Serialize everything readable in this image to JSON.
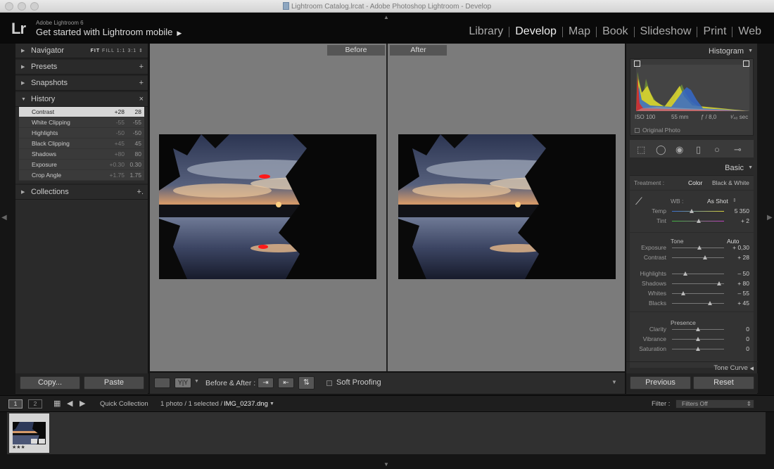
{
  "window": {
    "title": "Lightroom Catalog.lrcat - Adobe Photoshop Lightroom - Develop"
  },
  "identity": {
    "logo": "Lr",
    "product": "Adobe Lightroom 6",
    "mobile_prompt": "Get started with Lightroom mobile",
    "mobile_arrow": "▶"
  },
  "modules": [
    {
      "label": "Library",
      "active": false
    },
    {
      "label": "Develop",
      "active": true
    },
    {
      "label": "Map",
      "active": false
    },
    {
      "label": "Book",
      "active": false
    },
    {
      "label": "Slideshow",
      "active": false
    },
    {
      "label": "Print",
      "active": false
    },
    {
      "label": "Web",
      "active": false
    }
  ],
  "left_panel": {
    "navigator": {
      "title": "Navigator",
      "opt_fit": "FIT",
      "opt_fill": "FILL",
      "opt_1": "1:1",
      "opt_3": "3:1",
      "opt_arrow": "⇕"
    },
    "presets": {
      "title": "Presets",
      "action": "+"
    },
    "snapshots": {
      "title": "Snapshots",
      "action": "+"
    },
    "history": {
      "title": "History",
      "action": "×",
      "items": [
        {
          "name": "Contrast",
          "delta": "+28",
          "value": "28",
          "selected": true
        },
        {
          "name": "White Clipping",
          "delta": "-55",
          "value": "-55",
          "selected": false
        },
        {
          "name": "Highlights",
          "delta": "-50",
          "value": "-50",
          "selected": false
        },
        {
          "name": "Black Clipping",
          "delta": "+45",
          "value": "45",
          "selected": false
        },
        {
          "name": "Shadows",
          "delta": "+80",
          "value": "80",
          "selected": false
        },
        {
          "name": "Exposure",
          "delta": "+0.30",
          "value": "0.30",
          "selected": false
        },
        {
          "name": "Crop Angle",
          "delta": "+1.75",
          "value": "1.75",
          "selected": false
        }
      ]
    },
    "collections": {
      "title": "Collections",
      "action": "+."
    },
    "copy_label": "Copy...",
    "paste_label": "Paste"
  },
  "center": {
    "before_label": "Before",
    "after_label": "After"
  },
  "toolbar": {
    "view_yy": "Y|Y",
    "ba_label": "Before & After :",
    "soft_proofing": "Soft Proofing",
    "dropdown_arrow": "▼"
  },
  "right_panel": {
    "histogram": {
      "title": "Histogram",
      "iso": "ISO 100",
      "focal": "55 mm",
      "aperture": "ƒ / 8,0",
      "shutter": "¹⁄₄₀ sec",
      "original_photo": "Original Photo"
    },
    "basic": {
      "title": "Basic",
      "treatment_label": "Treatment :",
      "treatment_color": "Color",
      "treatment_bw": "Black & White",
      "wb_label": "WB :",
      "wb_value": "As Shot",
      "tone_label": "Tone",
      "auto_label": "Auto",
      "presence_label": "Presence",
      "sliders": [
        {
          "label": "Temp",
          "value": "5 350",
          "pos": 0.38
        },
        {
          "label": "Tint",
          "value": "+ 2",
          "pos": 0.52
        },
        {
          "label": "Exposure",
          "value": "+ 0,30",
          "pos": 0.53
        },
        {
          "label": "Contrast",
          "value": "+ 28",
          "pos": 0.64
        },
        {
          "label": "Highlights",
          "value": "– 50",
          "pos": 0.25
        },
        {
          "label": "Shadows",
          "value": "+ 80",
          "pos": 0.9
        },
        {
          "label": "Whites",
          "value": "– 55",
          "pos": 0.22
        },
        {
          "label": "Blacks",
          "value": "+ 45",
          "pos": 0.73
        },
        {
          "label": "Clarity",
          "value": "0",
          "pos": 0.5
        },
        {
          "label": "Vibrance",
          "value": "0",
          "pos": 0.5
        },
        {
          "label": "Saturation",
          "value": "0",
          "pos": 0.5
        }
      ]
    },
    "tone_curve": "Tone Curve",
    "previous_label": "Previous",
    "reset_label": "Reset"
  },
  "filmbar": {
    "screen1": "1",
    "screen2": "2",
    "source": "Quick Collection",
    "info": "1 photo / 1 selected /",
    "filename": "IMG_0237.dng",
    "filter_label": "Filter :",
    "filter_value": "Filters Off"
  },
  "filmstrip": {
    "stars": "★★★"
  }
}
